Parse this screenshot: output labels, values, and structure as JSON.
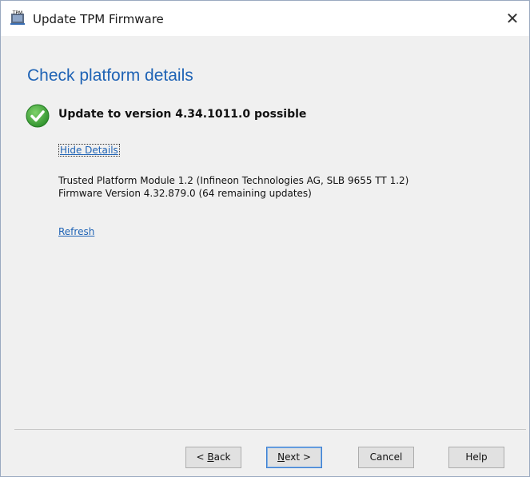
{
  "window": {
    "title": "Update TPM Firmware",
    "icon": "tpm-icon",
    "close_glyph": "✕"
  },
  "main": {
    "heading": "Check platform details",
    "status": {
      "icon": "success-check-icon",
      "text": "Update to version 4.34.1011.0 possible"
    },
    "hide_details_link": "Hide Details",
    "details": [
      "Trusted Platform Module 1.2 (Infineon Technologies AG, SLB 9655 TT 1.2)",
      "Firmware Version 4.32.879.0 (64 remaining updates)"
    ],
    "refresh_link": "Refresh"
  },
  "footer": {
    "back_pre": "< ",
    "back_key": "B",
    "back_post": "ack",
    "next_key": "N",
    "next_post": "ext >",
    "cancel": "Cancel",
    "help": "Help"
  },
  "colors": {
    "accent": "#1f63b5",
    "success": "#3aa535",
    "background": "#f0f0f0"
  }
}
